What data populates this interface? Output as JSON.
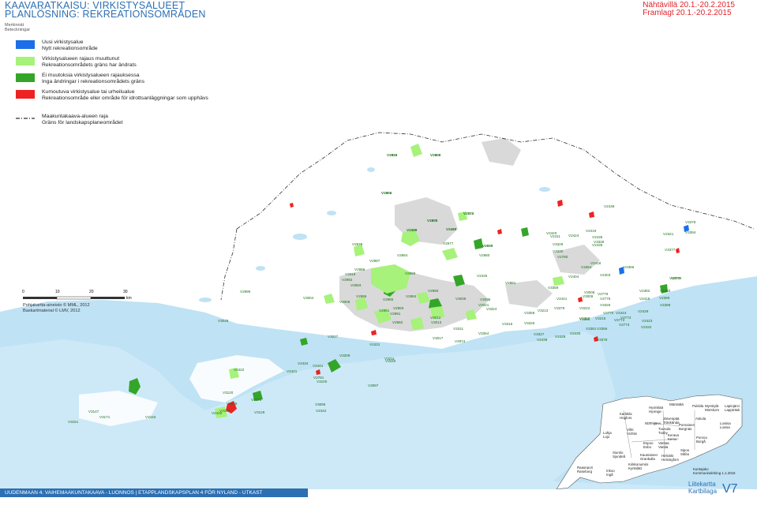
{
  "header": {
    "title_fi": "KAAVARATKAISU: VIRKISTYSALUEET",
    "title_sv": "PLANLÖSNING: REKREATIONSOMRÅDEN",
    "date_fi": "Nähtävillä 20.1.-20.2.2015",
    "date_sv": "Framlagt 20.1.-20.2.2015"
  },
  "legend": {
    "heading_fi": "Merkinnät",
    "heading_sv": "Beteckningar",
    "items": [
      {
        "fi": "Uusi virkistysalue",
        "sv": "Nytt rekreationsområde",
        "color": "#1a6fe8"
      },
      {
        "fi": "Virkistysalueen rajaus muuttunut",
        "sv": "Rekreationsområdets gräns har ändrats",
        "color": "#a6f27a"
      },
      {
        "fi": "Ei muutoksia virkistysalueen rajauksessa",
        "sv": "Inga ändringar i rekreationsområdets gräns",
        "color": "#35a52a"
      },
      {
        "fi": "Kumoutuva virkistysalue tai urheilualue",
        "sv": "Rekreationsområde eller område för idrottsanläggningar som upphävs",
        "color": "#ee2222"
      }
    ],
    "boundary": {
      "fi": "Maakuntakaava-alueen raja",
      "sv": "Gräns för landskapsplaneområdet"
    }
  },
  "scale": {
    "ticks": [
      "0",
      "10",
      "20",
      "30"
    ],
    "unit": "km"
  },
  "credits": {
    "line1": "Pohjakartta-aineisto © MML, 2012",
    "line2": "Baskartmaterial © LMV, 2012"
  },
  "map_labels": [
    "V2959",
    "V2958",
    "V2962",
    "V2872",
    "V2975",
    "V2416",
    "V2445",
    "V2978",
    "V2977",
    "V2975",
    "V2884",
    "V2987",
    "V2980",
    "V3319",
    "V2986",
    "V2992",
    "V2993",
    "V2989",
    "V2425",
    "V2861",
    "V2990",
    "V2996",
    "V2985",
    "V2984",
    "V3004",
    "V3006",
    "V2995",
    "V2983",
    "V2991",
    "V2981",
    "V2982",
    "V3048",
    "V3012",
    "V3013",
    "V3311",
    "V3027",
    "V3017",
    "V2974",
    "V3036",
    "V3035",
    "V3321",
    "V3324",
    "V3315",
    "V3326",
    "V3358",
    "V3359",
    "V2441",
    "V3379",
    "V3355",
    "V3354",
    "V3327",
    "V2438",
    "V2428",
    "V2430",
    "V2439",
    "V2778",
    "V2444",
    "V2435",
    "V2436",
    "V2418",
    "V3364",
    "V2404",
    "V2403",
    "V2366",
    "V2341",
    "V3378",
    "V3377",
    "V3383",
    "V2383",
    "V2389",
    "V2388",
    "V2382",
    "V2418",
    "V2429",
    "V2423",
    "V2432",
    "V2420",
    "V2431",
    "V2422",
    "V2421",
    "V2434",
    "V2441",
    "V2781",
    "V3100",
    "V3097",
    "V3096",
    "V2442",
    "V3128",
    "V3129",
    "V3105",
    "V3120",
    "V3148",
    "V2440",
    "V3147",
    "V3171",
    "V3153",
    "V3151",
    "V3150",
    "V3209",
    "V3211",
    "V3213",
    "V3222",
    "V3215",
    "V3008",
    "V3009",
    "V3326",
    "V2779",
    "V2775",
    "V2770",
    "V2773",
    "V2772",
    "V2774",
    "V3356",
    "V3357",
    "V3381",
    "V3378",
    "V2424",
    "V2411",
    "V2419",
    "V3328",
    "V3329",
    "V3330",
    "V2780",
    "V3394",
    "V2415",
    "V2405",
    "V2406",
    "V2410",
    "V2408",
    "V2409",
    "V2407",
    "V2338"
  ],
  "inset_labels": [
    "Mäntsälä",
    "Pukkila",
    "Myrskylä Mörskom",
    "Lapinjärvi Lappträsk",
    "Hyvinkää Hyvinge",
    "Järvenpää Träskända",
    "Askola",
    "Karkkila Högfors",
    "Tuusula Tusby",
    "Pornainen Borgnäs",
    "Loviisa Lovisa",
    "Nurmijärvi",
    "Kerava Kervo",
    "Vihti Vichtis",
    "Porvoo Borgå",
    "Lohja Lojo",
    "Espoo Esbo",
    "Vantaa Vanda",
    "Sipoo Sibbo",
    "Siuntio Sjundeå",
    "Kauniainen Grankulla",
    "Helsinki Helsingfors",
    "Kirkkonummi Kyrkslätt",
    "Raasepori Raseborg",
    "Inkoo Ingå",
    "Hanko Hangö",
    "Kuntajako Kommunindelning 1.1.2015"
  ],
  "bottom_bar": "UUDENMAAN 4. VAIHEMAAKUNTAKAAVA - LUONNOS  |  ETAPPLANDSKAPSPLAN 4 FÖR NYLAND - UTKAST",
  "sheet": {
    "title_fi": "Liitekartta",
    "title_sv": "Kartbilaga",
    "code": "V7"
  }
}
